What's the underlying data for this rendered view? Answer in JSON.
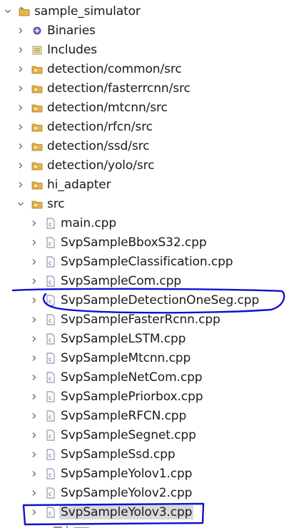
{
  "project": {
    "label": "sample_simulator",
    "icon": "project-folder-icon"
  },
  "project_children": [
    {
      "label": "Binaries",
      "icon": "binaries-icon"
    },
    {
      "label": "Includes",
      "icon": "includes-icon"
    },
    {
      "label": "detection/common/src",
      "icon": "source-folder-icon"
    },
    {
      "label": "detection/fasterrcnn/src",
      "icon": "source-folder-icon"
    },
    {
      "label": "detection/mtcnn/src",
      "icon": "source-folder-icon"
    },
    {
      "label": "detection/rfcn/src",
      "icon": "source-folder-icon"
    },
    {
      "label": "detection/ssd/src",
      "icon": "source-folder-icon"
    },
    {
      "label": "detection/yolo/src",
      "icon": "source-folder-icon"
    },
    {
      "label": "hi_adapter",
      "icon": "source-folder-icon"
    },
    {
      "label": "src",
      "icon": "source-folder-icon",
      "expanded": true
    }
  ],
  "src_files": [
    "main.cpp",
    "SvpSampleBboxS32.cpp",
    "SvpSampleClassification.cpp",
    "SvpSampleCom.cpp",
    "SvpSampleDetectionOneSeg.cpp",
    "SvpSampleFasterRcnn.cpp",
    "SvpSampleLSTM.cpp",
    "SvpSampleMtcnn.cpp",
    "SvpSampleNetCom.cpp",
    "SvpSamplePriorbox.cpp",
    "SvpSampleRFCN.cpp",
    "SvpSampleSegnet.cpp",
    "SvpSampleSsd.cpp",
    "SvpSampleYolov1.cpp",
    "SvpSampleYolov2.cpp",
    "SvpSampleYolov3.cpp"
  ],
  "selected_file": "SvpSampleYolov3.cpp",
  "annotation_color": "#1010d0"
}
